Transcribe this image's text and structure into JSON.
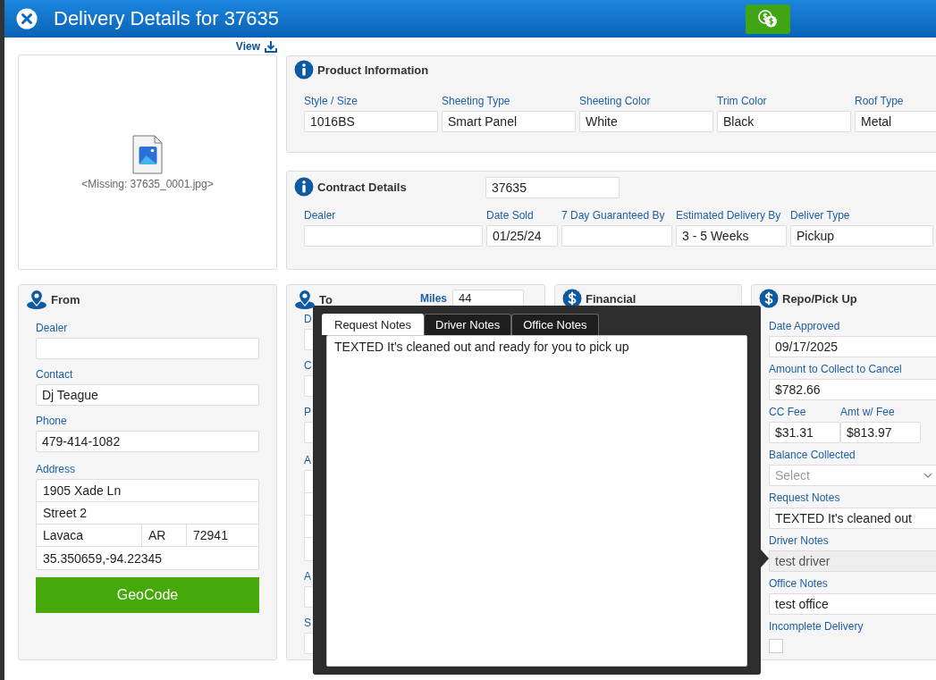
{
  "window": {
    "title": "Delivery Details for 37635"
  },
  "image": {
    "view_link": "View",
    "missing_text": "<Missing: 37635_0001.jpg>"
  },
  "product_information": {
    "title": "Product Information",
    "fields": [
      {
        "label": "Style / Size",
        "value": "1016BS"
      },
      {
        "label": "Sheeting Type",
        "value": "Smart Panel"
      },
      {
        "label": "Sheeting Color",
        "value": "White"
      },
      {
        "label": "Trim Color",
        "value": "Black"
      },
      {
        "label": "Roof Type",
        "value": "Metal"
      }
    ]
  },
  "contract_details": {
    "title": "Contract Details",
    "number": "37635",
    "fields": [
      {
        "label": "Dealer"
      },
      {
        "label": "Date Sold",
        "value": "01/25/24"
      },
      {
        "label": "7 Day Guaranteed By"
      },
      {
        "label": "Estimated Delivery By",
        "value": "3 - 5 Weeks"
      },
      {
        "label": "Deliver Type",
        "value": "Pickup"
      }
    ]
  },
  "from": {
    "title": "From",
    "fields": [
      {
        "kind": "text",
        "label": "Dealer"
      },
      {
        "kind": "text",
        "label": "Contact",
        "value": "Dj Teague"
      },
      {
        "kind": "text",
        "label": "Phone",
        "value": "479-414-1082"
      },
      {
        "kind": "address",
        "label": "Address",
        "street": "1905 Xade Ln",
        "street2_placeholder": "Street 2",
        "city": "Lavaca",
        "state": "AR",
        "zip": "72941",
        "coordinates": "35.350659,-94.22345"
      }
    ],
    "geocode_button": "GeoCode"
  },
  "to": {
    "title": "To",
    "miles_label": "Miles",
    "miles": "44",
    "fields": [
      {
        "kind": "text",
        "label": "D"
      },
      {
        "kind": "text",
        "label": "C"
      },
      {
        "kind": "text",
        "label": "P"
      },
      {
        "kind": "address",
        "label": "A"
      },
      {
        "kind": "text",
        "label": "A"
      },
      {
        "kind": "text",
        "label": "S"
      }
    ]
  },
  "financial": {
    "title": "Financial"
  },
  "repo": {
    "title": "Repo/Pick Up",
    "fields": [
      {
        "kind": "text",
        "label": "Date Approved",
        "value": "09/17/2025",
        "disabled": false
      },
      {
        "kind": "text",
        "label": "Amount to Collect to Cancel",
        "value": "$782.66",
        "disabled": false
      },
      {
        "kind": "pair",
        "label": "CC Fee",
        "value": "$31.31",
        "label_2": "Amt w/ Fee",
        "value_2": "$813.97"
      },
      {
        "kind": "select",
        "label": "Balance Collected",
        "placeholder": "Select"
      },
      {
        "kind": "text",
        "label": "Request Notes",
        "value": "TEXTED It's cleaned out",
        "disabled": false
      },
      {
        "kind": "text",
        "label": "Driver Notes",
        "value": "test driver",
        "disabled": true
      },
      {
        "kind": "text",
        "label": "Office Notes",
        "value": "test office",
        "disabled": false
      },
      {
        "kind": "checkbox",
        "label": "Incomplete Delivery",
        "checked": false
      }
    ]
  },
  "notes_popup": {
    "tabs": [
      {
        "label": "Request Notes",
        "selected": true
      },
      {
        "label": "Driver Notes",
        "selected": false
      },
      {
        "label": "Office Notes",
        "selected": false
      }
    ],
    "text": "TEXTED It's cleaned out and ready for you to pick up"
  }
}
